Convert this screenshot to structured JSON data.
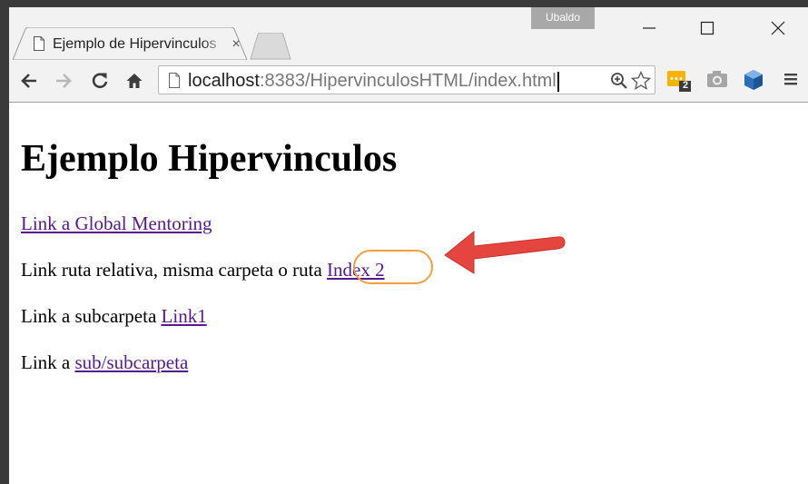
{
  "window": {
    "profile_name": "Ubaldo"
  },
  "tab": {
    "title": "Ejemplo de Hipervinculos",
    "close_glyph": "×"
  },
  "address_bar": {
    "url_host": "localhost",
    "url_rest": ":8383/HipervinculosHTML/index.html"
  },
  "extensions": {
    "badge_count": "2"
  },
  "page": {
    "heading": "Ejemplo Hipervinculos",
    "lines": [
      {
        "prefix": "",
        "link": "Link a Global Mentoring"
      },
      {
        "prefix": "Link ruta relativa, misma carpeta o ruta ",
        "link": "Index 2"
      },
      {
        "prefix": "Link a subcarpeta ",
        "link": "Link1"
      },
      {
        "prefix": "Link a ",
        "link": "sub/subcarpeta"
      }
    ]
  },
  "colors": {
    "link_visited": "#551a8b",
    "highlight": "#f0a040",
    "arrow": "#e4453f",
    "chrome_frame": "#f2f2f2"
  },
  "icons": [
    "page-icon",
    "close-icon",
    "minimize-icon",
    "maximize-icon",
    "back-arrow-icon",
    "forward-arrow-icon",
    "reload-icon",
    "home-icon",
    "zoom-icon",
    "star-icon",
    "extension-badge-icon",
    "camera-icon",
    "cube-icon",
    "menu-icon"
  ]
}
